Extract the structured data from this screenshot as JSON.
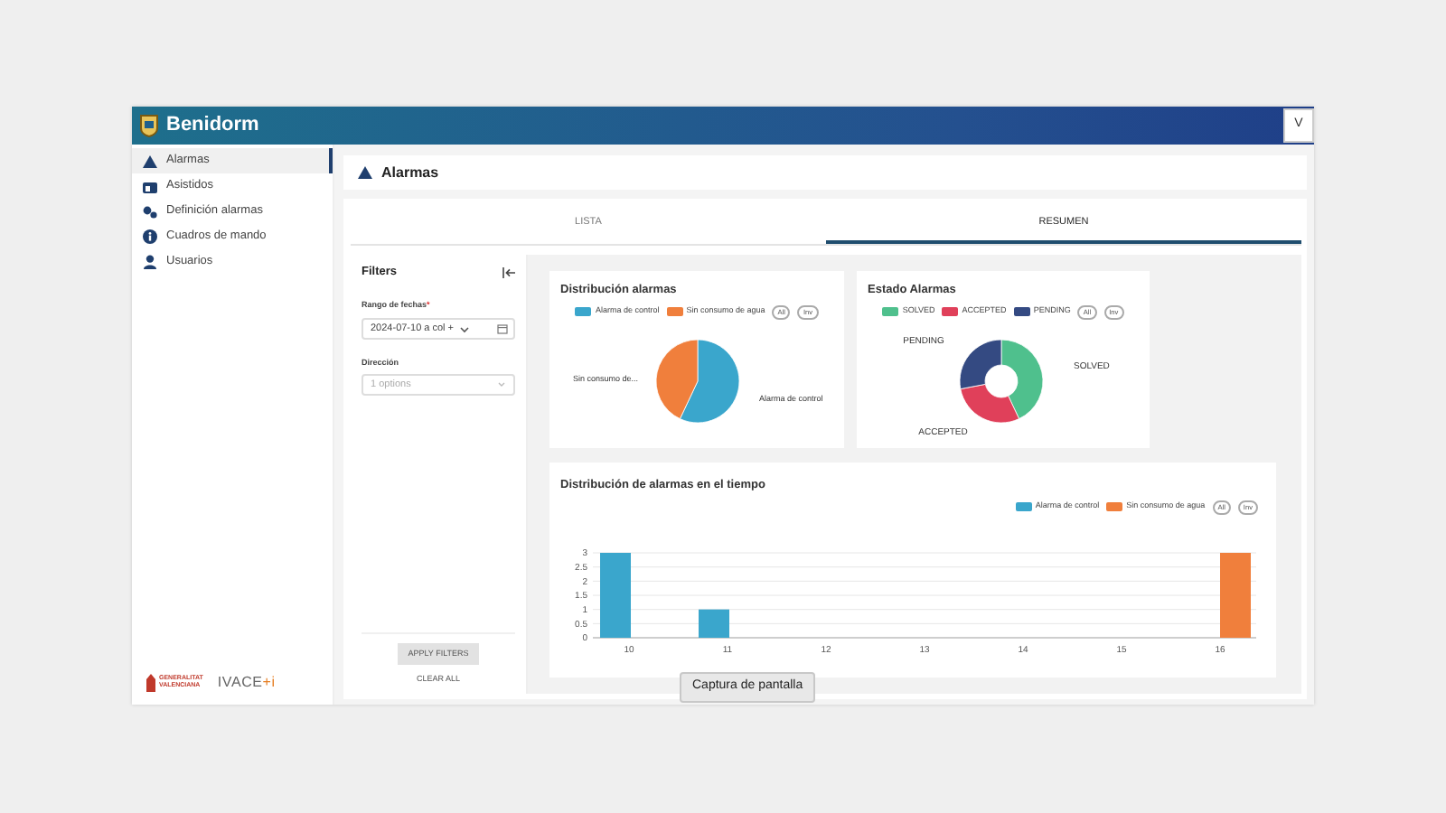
{
  "header": {
    "title": "Benidorm",
    "user_button": "V"
  },
  "sidebar": {
    "items": [
      {
        "label": "Alarmas",
        "selected": true
      },
      {
        "label": "Asistidos",
        "selected": false
      },
      {
        "label": "Definición alarmas",
        "selected": false
      },
      {
        "label": "Cuadros de mando",
        "selected": false
      },
      {
        "label": "Usuarios",
        "selected": false
      }
    ],
    "footer_logos": [
      {
        "kind": "generalitat",
        "lines": [
          "GENERALITAT",
          "VALENCIANA"
        ]
      },
      {
        "kind": "ivace",
        "text": "IVACE",
        "accent": "+i"
      }
    ]
  },
  "page_title": "Alarmas",
  "tabs": [
    {
      "label": "LISTA",
      "selected": false
    },
    {
      "label": "RESUMEN",
      "selected": true
    }
  ],
  "filters": {
    "title": "Filters",
    "fields": [
      {
        "kind": "date",
        "label": "Rango de fechas",
        "required_mark": "*",
        "value": "2024-07-10 a col +"
      },
      {
        "kind": "select",
        "label": "Dirección",
        "placeholder": "1 options"
      }
    ],
    "apply_button": "APPLY FILTERS",
    "clear_button": "CLEAR ALL"
  },
  "charts": [
    {
      "title": "Distribución alarmas",
      "legend": [
        {
          "color": "#3aa6cc"
        },
        {
          "color": "#f07f3c"
        }
      ],
      "toggle_buttons": [
        "All",
        "Inv"
      ],
      "slice_labels": [
        "Alarma de control",
        "Sin consumo de..."
      ],
      "chart_data": {
        "type": "pie",
        "categories": [
          "Alarma de control",
          "Sin consumo de agua"
        ],
        "values": [
          57,
          43
        ]
      }
    },
    {
      "title": "Estado Alarmas",
      "legend": [
        {
          "color": "#4fc08d"
        },
        {
          "color": "#e0405a"
        },
        {
          "color": "#344a82"
        }
      ],
      "toggle_buttons": [
        "All",
        "Inv"
      ],
      "slice_labels": [
        "SOLVED",
        "ACCEPTED",
        "PENDING"
      ],
      "chart_data": {
        "type": "donut",
        "categories": [
          "SOLVED",
          "ACCEPTED",
          "PENDING"
        ],
        "values": [
          43,
          29,
          28
        ]
      }
    },
    {
      "title": "Distribución de alarmas en el tiempo",
      "toggle_buttons": [
        "All",
        "Inv"
      ],
      "chart_data": {
        "type": "bar",
        "categories": [
          "10",
          "11",
          "12",
          "13",
          "14",
          "15",
          "16"
        ],
        "series": [
          {
            "name": "Alarma de control",
            "color": "#3aa6cc",
            "values": [
              3,
              1,
              0,
              0,
              0,
              0,
              0
            ]
          },
          {
            "name": "Sin consumo de agua",
            "color": "#f07f3c",
            "values": [
              0,
              0,
              0,
              0,
              0,
              0,
              3
            ]
          }
        ],
        "ylim": [
          0,
          3
        ],
        "yticks": [
          0,
          0.5,
          1,
          1.5,
          2,
          2.5,
          3
        ],
        "grid": true
      }
    }
  ],
  "tooltip": "Captura de pantalla"
}
